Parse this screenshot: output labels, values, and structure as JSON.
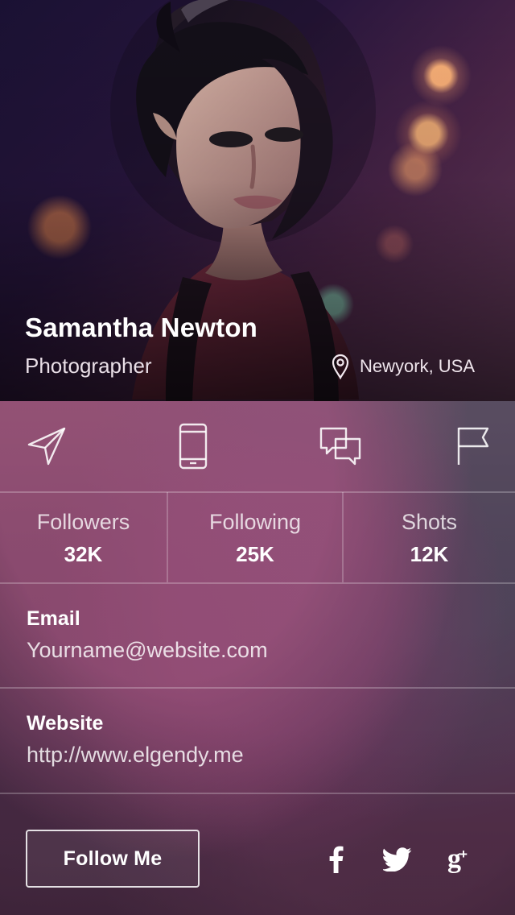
{
  "profile": {
    "name": "Samantha Newton",
    "role": "Photographer",
    "location": "Newyork, USA"
  },
  "actions": [
    {
      "icon": "send-icon"
    },
    {
      "icon": "phone-icon"
    },
    {
      "icon": "chat-icon"
    },
    {
      "icon": "flag-icon"
    }
  ],
  "stats": [
    {
      "label": "Followers",
      "value": "32K"
    },
    {
      "label": "Following",
      "value": "25K"
    },
    {
      "label": "Shots",
      "value": "12K"
    }
  ],
  "contact": {
    "email_label": "Email",
    "email_value": "Yourname@website.com",
    "website_label": "Website",
    "website_value": "http://www.elgendy.me"
  },
  "footer": {
    "follow_label": "Follow Me",
    "social_icons": [
      "facebook-icon",
      "twitter-icon",
      "google-plus-icon"
    ]
  },
  "colors": {
    "text_primary": "#ffffff",
    "panel_tint": "#57324b",
    "divider": "#ffffff"
  }
}
